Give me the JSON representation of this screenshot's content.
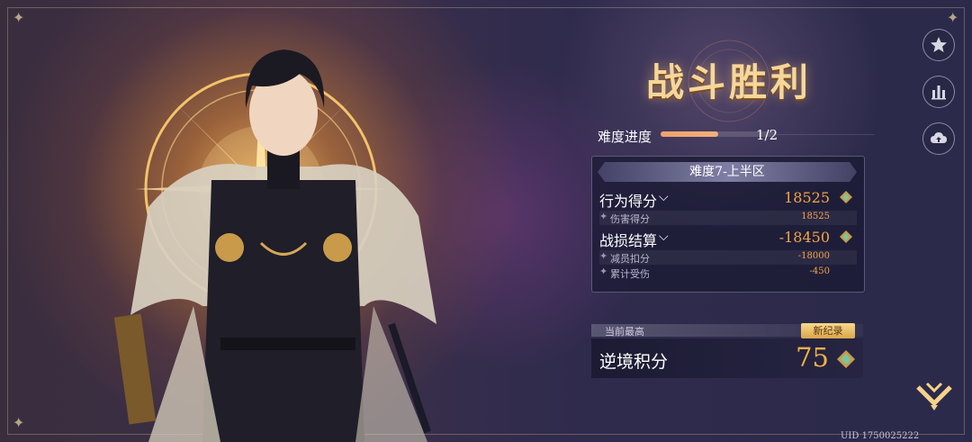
{
  "result": {
    "title": "战斗胜利"
  },
  "progress": {
    "label": "难度进度",
    "value_text": "1/2",
    "fraction": 0.5
  },
  "panel": {
    "header": "难度7-上半区",
    "behavior": {
      "label": "行为得分",
      "value": "18525"
    },
    "damage_sub": {
      "label": "伤害得分",
      "value": "18525"
    },
    "loss": {
      "label": "战损结算",
      "value": "-18450"
    },
    "reduction_sub": {
      "label": "减员扣分",
      "value": "-18000"
    },
    "hurt_sub": {
      "label": "累计受伤",
      "value": "-450"
    }
  },
  "score": {
    "sub_label": "当前最高",
    "badge": "新纪录",
    "label": "逆境积分",
    "value": "75"
  },
  "side_buttons": [
    "star-icon",
    "bar-chart-icon",
    "cloud-upload-icon"
  ],
  "footer": {
    "uid": "UID 1750025222"
  },
  "colors": {
    "accent_orange": "#f3a447",
    "title_gold": "#f6d79a",
    "progress": "#f0a26a"
  }
}
